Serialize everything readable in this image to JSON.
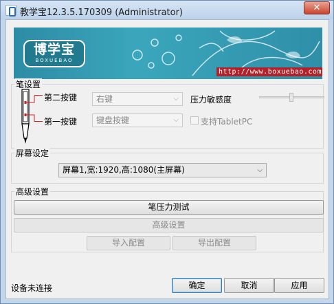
{
  "window": {
    "title": "教学宝12.3.5.170309 (Administrator)",
    "close_glyph": "✕"
  },
  "banner": {
    "logo_text": "博学宝",
    "logo_sub": "BOXUEBAO",
    "url": "http://www.boxuebao.com"
  },
  "pen_settings": {
    "group_label": "笔设置",
    "second_key_label": "第二按键",
    "second_key_value": "右键",
    "first_key_label": "第一按键",
    "first_key_value": "键盘按键",
    "pressure_label": "压力敏感度",
    "pressure_level": 0.55,
    "tabletpc_label": "支持TabletPC",
    "tabletpc_checked": false
  },
  "screen_settings": {
    "group_label": "屏幕设定",
    "screen_value": "屏幕1,宽:1920,高:1080(主屏幕)"
  },
  "advanced": {
    "group_label": "高级设置",
    "pressure_test_button": "笔压力测试",
    "advanced_button": "高级设置",
    "import_button": "导入配置",
    "export_button": "导出配置"
  },
  "footer": {
    "status_text": "设备未连接",
    "ok_button": "确定",
    "cancel_button": "取消",
    "apply_button": "应用"
  },
  "colors": {
    "banner": "#3aa6bc",
    "url_bg": "#b3212b",
    "pen_marker": "#d21f1f"
  }
}
